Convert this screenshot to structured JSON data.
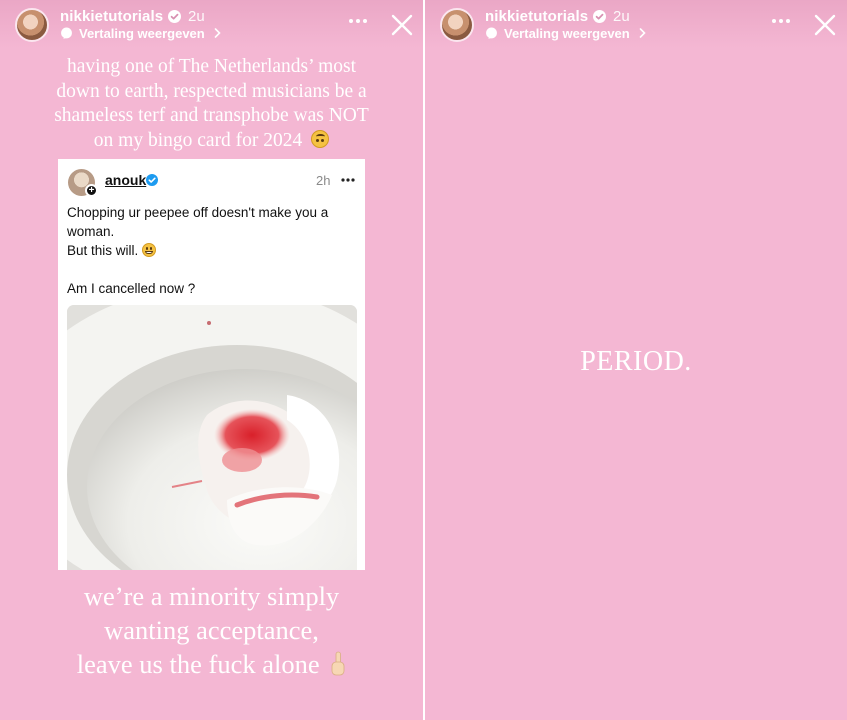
{
  "stories": [
    {
      "username": "nikkietutorials",
      "time": "2u",
      "translate_label": "Vertaling weergeven",
      "caption_top": [
        "having one of The Netherlands’ most",
        "down to earth, respected musicians be a",
        "shameless terf and transphobe was NOT",
        "on my bingo card for 2024"
      ],
      "embedded_post": {
        "username": "anouk",
        "time": "2h",
        "lines": [
          "Chopping ur peepee off doesn't make you a",
          "woman.",
          "But this will.",
          "",
          "Am I cancelled now ?"
        ]
      },
      "caption_bottom": [
        "we’re a minority simply",
        "wanting acceptance,",
        "leave us the fuck alone"
      ]
    },
    {
      "username": "nikkietutorials",
      "time": "2u",
      "translate_label": "Vertaling weergeven",
      "center_text": "PERIOD."
    }
  ],
  "icons": {
    "verified": "verified-badge-icon",
    "translate": "translate-icon",
    "more": "more-options-icon",
    "close": "close-icon"
  },
  "colors": {
    "story_background": "#f4b7d3",
    "text": "#ffffff",
    "verified_blue": "#1d9bf0"
  }
}
